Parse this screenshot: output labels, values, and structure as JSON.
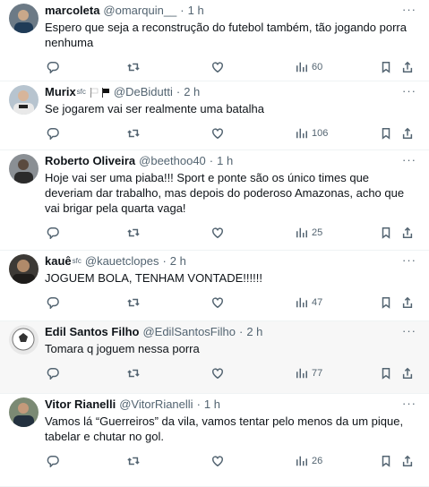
{
  "tweets": [
    {
      "name": "marcoleta",
      "badges": "",
      "handle": "@omarquin__",
      "time": "1 h",
      "text": "Espero que seja a reconstrução do futebol também, tão jogando porra nenhuma",
      "views": "60"
    },
    {
      "name": "Murix",
      "badges": "sfc",
      "handle": "@DeBidutti",
      "time": "2 h",
      "text": "Se jogarem vai ser realmente uma batalha",
      "views": "106"
    },
    {
      "name": "Roberto Oliveira",
      "badges": "",
      "handle": "@beethoo40",
      "time": "1 h",
      "text": "Hoje vai ser uma piaba!!! Sport e ponte são os único times que deveriam dar trabalho, mas depois do poderoso Amazonas, acho que vai brigar pela quarta vaga!",
      "views": "25"
    },
    {
      "name": "kauê",
      "badges": "sfc",
      "handle": "@kauetclopes",
      "time": "2 h",
      "text": "JOGUEM BOLA, TENHAM VONTADE!!!!!!",
      "views": "47"
    },
    {
      "name": "Edil Santos Filho",
      "badges": "",
      "handle": "@EdilSantosFilho",
      "time": "2 h",
      "text": "Tomara q joguem nessa porra",
      "views": "77"
    },
    {
      "name": "Vitor Rianelli",
      "badges": "",
      "handle": "@VitorRianelli",
      "time": "1 h",
      "text": "Vamos lá “Guerreiros” da vila, vamos tentar pelo menos da um pique, tabelar e chutar no gol.",
      "views": "26"
    }
  ],
  "separator": "·",
  "colors": {
    "text": "#0f1419",
    "muted": "#536471",
    "border": "#eff3f4",
    "hover_bg": "#f7f7f7"
  },
  "icons": [
    "reply-icon",
    "retweet-icon",
    "like-icon",
    "views-icon",
    "bookmark-icon",
    "share-icon",
    "more-icon"
  ]
}
